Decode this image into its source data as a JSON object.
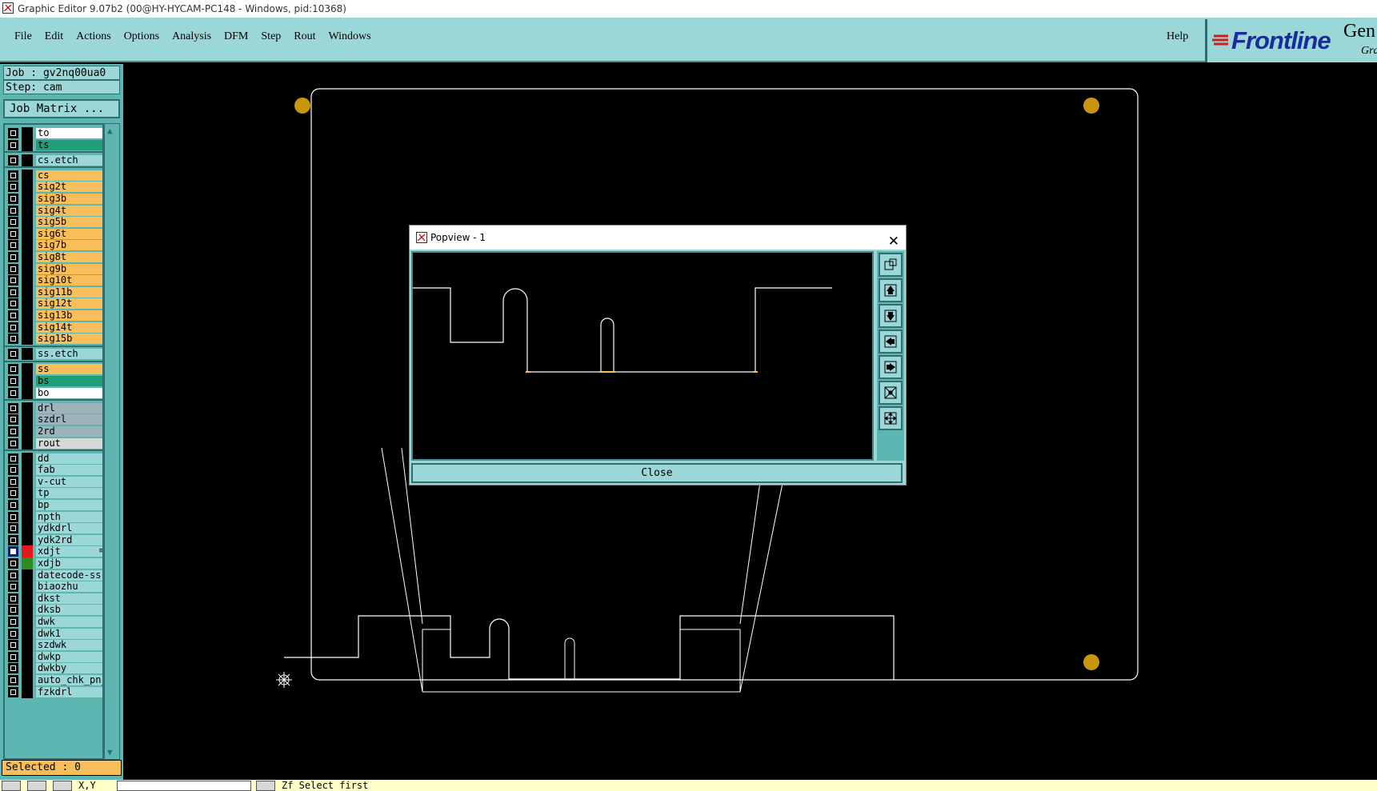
{
  "window": {
    "title": "Graphic Editor 9.07b2 (00@HY-HYCAM-PC148 - Windows, pid:10368)"
  },
  "menu": {
    "items": [
      "File",
      "Edit",
      "Actions",
      "Options",
      "Analysis",
      "DFM",
      "Step",
      "Rout",
      "Windows"
    ],
    "help": "Help"
  },
  "brand": {
    "name": "Frontline",
    "gen": "Gen",
    "gra": "Gra"
  },
  "job": {
    "job_line": "Job : gv2nq00ua0",
    "step_line": "Step: cam",
    "matrix_button": "Job Matrix ..."
  },
  "layers": [
    {
      "name": "to",
      "color": "#ffffff"
    },
    {
      "name": "ts",
      "color": "#1f9e78"
    },
    {
      "name": "cs.etch",
      "color": "#9cd7d8"
    },
    {
      "name": "cs",
      "color": "#f8be5a"
    },
    {
      "name": "sig2t",
      "color": "#f8be5a"
    },
    {
      "name": "sig3b",
      "color": "#f8be5a"
    },
    {
      "name": "sig4t",
      "color": "#f8be5a"
    },
    {
      "name": "sig5b",
      "color": "#f8be5a"
    },
    {
      "name": "sig6t",
      "color": "#f8be5a"
    },
    {
      "name": "sig7b",
      "color": "#f8be5a"
    },
    {
      "name": "sig8t",
      "color": "#f8be5a"
    },
    {
      "name": "sig9b",
      "color": "#f8be5a"
    },
    {
      "name": "sig10t",
      "color": "#f8be5a"
    },
    {
      "name": "sig11b",
      "color": "#f8be5a"
    },
    {
      "name": "sig12t",
      "color": "#f8be5a"
    },
    {
      "name": "sig13b",
      "color": "#f8be5a"
    },
    {
      "name": "sig14t",
      "color": "#f8be5a"
    },
    {
      "name": "sig15b",
      "color": "#f8be5a"
    },
    {
      "name": "ss.etch",
      "color": "#9cd7d8"
    },
    {
      "name": "ss",
      "color": "#f8be5a"
    },
    {
      "name": "bs",
      "color": "#1f9e78"
    },
    {
      "name": "bo",
      "color": "#ffffff"
    },
    {
      "name": "drl",
      "color": "#9db4bc"
    },
    {
      "name": "szdrl",
      "color": "#9db4bc"
    },
    {
      "name": "2rd",
      "color": "#9db4bc"
    },
    {
      "name": "rout",
      "color": "#d8d8d8"
    },
    {
      "name": "dd",
      "color": "#9cd7d8"
    },
    {
      "name": "fab",
      "color": "#9cd7d8"
    },
    {
      "name": "v-cut",
      "color": "#9cd7d8"
    },
    {
      "name": "tp",
      "color": "#9cd7d8"
    },
    {
      "name": "bp",
      "color": "#9cd7d8"
    },
    {
      "name": "npth",
      "color": "#9cd7d8"
    },
    {
      "name": "ydkdrl",
      "color": "#9cd7d8"
    },
    {
      "name": "ydk2rd",
      "color": "#9cd7d8"
    },
    {
      "name": "xdjt",
      "color": "#9cd7d8",
      "active": true,
      "swatch": "#e8141e",
      "marker": "≡"
    },
    {
      "name": "xdjb",
      "color": "#9cd7d8",
      "swatch": "#2e8b1e"
    },
    {
      "name": "datecode-ss",
      "color": "#9cd7d8"
    },
    {
      "name": "biaozhu",
      "color": "#9cd7d8"
    },
    {
      "name": "dkst",
      "color": "#9cd7d8"
    },
    {
      "name": "dksb",
      "color": "#9cd7d8"
    },
    {
      "name": "dwk",
      "color": "#9cd7d8"
    },
    {
      "name": "dwk1",
      "color": "#9cd7d8"
    },
    {
      "name": "szdwk",
      "color": "#9cd7d8"
    },
    {
      "name": "dwkp",
      "color": "#9cd7d8"
    },
    {
      "name": "dwkby",
      "color": "#9cd7d8"
    },
    {
      "name": "auto_chk_pn_",
      "color": "#9cd7d8"
    },
    {
      "name": "fzkdrl",
      "color": "#9cd7d8"
    }
  ],
  "selected": "Selected : 0",
  "popview": {
    "title": "Popview - 1",
    "close_label": "Close"
  },
  "statusbar": {
    "xy_label": "X,Y",
    "message": "Zf  Select first"
  },
  "colors": {
    "panel": "#9cd7d8",
    "panel_dark": "#5db7b0",
    "signal_layer": "#f8be5a",
    "fiducial": "#c8960a"
  }
}
